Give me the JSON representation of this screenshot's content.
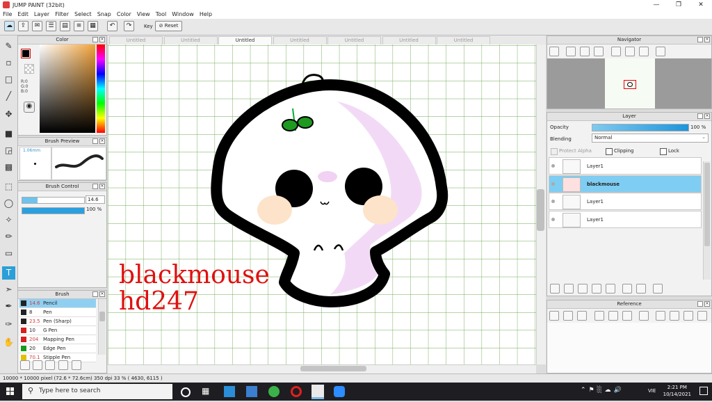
{
  "window": {
    "title": "JUMP PAINT (32bit)"
  },
  "menu": [
    "File",
    "Edit",
    "Layer",
    "Filter",
    "Select",
    "Snap",
    "Color",
    "View",
    "Tool",
    "Window",
    "Help"
  ],
  "toolbar": {
    "key_label": "Key",
    "reset_label": "Reset"
  },
  "tabs": [
    "Untitled",
    "Untitled",
    "Untitled",
    "Untitled",
    "Untitled",
    "Untitled",
    "Untitled"
  ],
  "active_tab_index": 2,
  "color_panel": {
    "title": "Color",
    "r": "R:0",
    "g": "G:0",
    "b": "B:0",
    "fg": "#000000",
    "bg": "#ffffff"
  },
  "brush_preview": {
    "title": "Brush Preview",
    "size": "1.06mm"
  },
  "brush_control": {
    "title": "Brush Control",
    "size_value": "14.6",
    "size_fraction": 0.25,
    "opacity_value": "100 %",
    "opacity_fraction": 1.0
  },
  "brush_panel": {
    "title": "Brush",
    "items": [
      {
        "size": "14.6",
        "name": "Pencil",
        "color": "#222222"
      },
      {
        "size": "8",
        "name": "Pen",
        "color": "#222222"
      },
      {
        "size": "23.5",
        "name": "Pen (Sharp)",
        "color": "#222222"
      },
      {
        "size": "10",
        "name": "G Pen",
        "color": "#d62020"
      },
      {
        "size": "204",
        "name": "Mapping Pen",
        "color": "#d62020"
      },
      {
        "size": "20",
        "name": "Edge Pen",
        "color": "#1a9a1a"
      },
      {
        "size": "70.1",
        "name": "Stipple Pen",
        "color": "#e0c000"
      }
    ]
  },
  "canvas": {
    "watermark_line1": "blackmouse",
    "watermark_line2": "hd247",
    "watermark_color": "#e01010"
  },
  "navigator": {
    "title": "Navigator"
  },
  "layer_panel": {
    "title": "Layer",
    "opacity_label": "Opacity",
    "opacity_value": "100 %",
    "opacity_fraction": 1.0,
    "blending_label": "Blending",
    "blending_value": "Normal",
    "protect_alpha": "Protect Alpha",
    "clipping": "Clipping",
    "lock": "Lock",
    "layers": [
      {
        "name": "Layer1",
        "selected": false
      },
      {
        "name": "blackmouse",
        "selected": true
      },
      {
        "name": "Layer1",
        "selected": false
      },
      {
        "name": "Layer1",
        "selected": false
      }
    ]
  },
  "reference_panel": {
    "title": "Reference"
  },
  "status": {
    "text": "10000 * 10000 pixel  (72.6 * 72.6cm)  350 dpi  33 %  ( 4630, 6115 )"
  },
  "taskbar": {
    "search_placeholder": "Type here to search",
    "time": "2:21 PM",
    "date": "10/14/2021",
    "lang": "VIE"
  }
}
